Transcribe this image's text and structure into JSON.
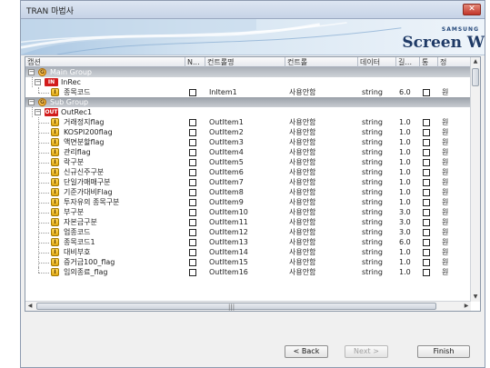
{
  "window": {
    "title": "TRAN 마법사",
    "close_glyph": "✕"
  },
  "banner": {
    "brand": "SAMSUNG",
    "title": "Screen W"
  },
  "grid": {
    "headers": [
      "캡션",
      "N...",
      "컨트롤명",
      "컨트롤",
      "데이터",
      "길...",
      "통",
      "정"
    ],
    "groups": [
      {
        "label": "Main Group",
        "expander": "−",
        "icon": "G"
      },
      {
        "label": "Sub Group",
        "expander": "−",
        "icon": "G"
      }
    ],
    "records": [
      {
        "label": "InRec",
        "expander": "−",
        "icon": "IN"
      },
      {
        "label": "OutRec1",
        "expander": "−",
        "icon": "OUT"
      }
    ],
    "in_items": [
      {
        "caption": "종목코드",
        "name": "InItem1",
        "control": "사용안함",
        "type": "string",
        "len": "6.0",
        "extra": "원"
      }
    ],
    "out_items": [
      {
        "caption": "거래정지flag",
        "name": "OutItem1",
        "control": "사용안함",
        "type": "string",
        "len": "1.0",
        "extra": "원"
      },
      {
        "caption": "KOSPI200flag",
        "name": "OutItem2",
        "control": "사용안함",
        "type": "string",
        "len": "1.0",
        "extra": "원"
      },
      {
        "caption": "액면분할flag",
        "name": "OutItem3",
        "control": "사용안함",
        "type": "string",
        "len": "1.0",
        "extra": "원"
      },
      {
        "caption": "관리flag",
        "name": "OutItem4",
        "control": "사용안함",
        "type": "string",
        "len": "1.0",
        "extra": "원"
      },
      {
        "caption": "락구분",
        "name": "OutItem5",
        "control": "사용안함",
        "type": "string",
        "len": "1.0",
        "extra": "원"
      },
      {
        "caption": "신규신주구분",
        "name": "OutItem6",
        "control": "사용안함",
        "type": "string",
        "len": "1.0",
        "extra": "원"
      },
      {
        "caption": "단일가매매구분",
        "name": "OutItem7",
        "control": "사용안함",
        "type": "string",
        "len": "1.0",
        "extra": "원"
      },
      {
        "caption": "기준가대비Flag",
        "name": "OutItem8",
        "control": "사용안함",
        "type": "string",
        "len": "1.0",
        "extra": "원"
      },
      {
        "caption": "투자유의 종목구분",
        "name": "OutItem9",
        "control": "사용안함",
        "type": "string",
        "len": "1.0",
        "extra": "원"
      },
      {
        "caption": "부구분",
        "name": "OutItem10",
        "control": "사용안함",
        "type": "string",
        "len": "3.0",
        "extra": "원"
      },
      {
        "caption": "자본금구분",
        "name": "OutItem11",
        "control": "사용안함",
        "type": "string",
        "len": "3.0",
        "extra": "원"
      },
      {
        "caption": "업종코드",
        "name": "OutItem12",
        "control": "사용안함",
        "type": "string",
        "len": "3.0",
        "extra": "원"
      },
      {
        "caption": "종목코드1",
        "name": "OutItem13",
        "control": "사용안함",
        "type": "string",
        "len": "6.0",
        "extra": "원"
      },
      {
        "caption": "대비부호",
        "name": "OutItem14",
        "control": "사용안함",
        "type": "string",
        "len": "1.0",
        "extra": "원"
      },
      {
        "caption": "증거금100_flag",
        "name": "OutItem15",
        "control": "사용안함",
        "type": "string",
        "len": "1.0",
        "extra": "원"
      },
      {
        "caption": "임의종료_flag",
        "name": "OutItem16",
        "control": "사용안함",
        "type": "string",
        "len": "1.0",
        "extra": "원"
      }
    ],
    "item_icon": "I",
    "scroll": {
      "up": "▲",
      "down": "▼",
      "left": "◀",
      "right": "▶",
      "grip": "|||"
    }
  },
  "buttons": {
    "back": "< Back",
    "next": "Next >",
    "finish": "Finish"
  },
  "colors": {
    "group_row": "#9aa0a8",
    "record_icon": "#d21c1c",
    "item_icon": "#e0a814"
  }
}
